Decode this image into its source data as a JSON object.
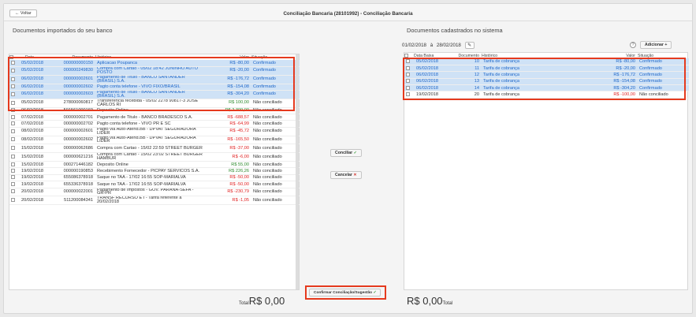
{
  "header": {
    "back_label": "Voltar",
    "title": "Conciliação Bancaria (28101992) - Conciliação Bancaria"
  },
  "left": {
    "heading": "Documentos importados do seu banco",
    "columns": [
      "Data",
      "Documento",
      "Histórico",
      "Valor",
      "Situação"
    ],
    "rows": [
      {
        "date": "05/02/2018",
        "doc": "000000000150",
        "hist": "Aplicacao Poupanca",
        "value": "R$ -80,00",
        "sign": "neg",
        "status": "Confirmado",
        "selected": true,
        "tall": false
      },
      {
        "date": "05/02/2018",
        "doc": "000000249830",
        "hist": "Compra com Cartao - 05/02 18:42 JUNINHO AUTO POSTO",
        "value": "R$ -20,00",
        "sign": "neg",
        "status": "Confirmado",
        "selected": true,
        "tall": true
      },
      {
        "date": "06/02/2018",
        "doc": "000000002601",
        "hist": "Pagamento de Titulo - BANCO SANTANDER (BRASIL) S.A.",
        "value": "R$ -176,72",
        "sign": "neg",
        "status": "Confirmado",
        "selected": true,
        "tall": true
      },
      {
        "date": "06/02/2018",
        "doc": "000000002602",
        "hist": "Pagto conta telefone - VIVO FIXO/BRASIL",
        "value": "R$ -154,08",
        "sign": "neg",
        "status": "Confirmado",
        "selected": true,
        "tall": false
      },
      {
        "date": "06/02/2018",
        "doc": "000000002603",
        "hist": "Pagamento de Titulo - BANCO SANTANDER (BRASIL) S.A.",
        "value": "R$ -304,20",
        "sign": "neg",
        "status": "Confirmado",
        "selected": true,
        "tall": true
      },
      {
        "date": "05/02/2018",
        "doc": "278000060817",
        "hist": "Transferencia recebida - 05/02 2278 90817-3 JOSE CARLOS RI",
        "value": "R$ 100,00",
        "sign": "pos",
        "status": "Não conciliado",
        "selected": false,
        "tall": true
      },
      {
        "date": "06/02/2018",
        "doc": "591561000169",
        "hist": "Deposito Online",
        "value": "R$ 2.309,00",
        "sign": "pos",
        "status": "Não conciliado",
        "selected": false,
        "tall": false
      },
      {
        "date": "07/02/2018",
        "doc": "000000002701",
        "hist": "Pagamento de Titulo - BANCO BRADESCO S.A.",
        "value": "R$ -688,57",
        "sign": "neg",
        "status": "Não conciliado",
        "selected": false,
        "tall": false
      },
      {
        "date": "07/02/2018",
        "doc": "000000002702",
        "hist": "Pagto conta telefone - VIVO PR E SC",
        "value": "R$ -64,99",
        "sign": "neg",
        "status": "Não conciliado",
        "selected": false,
        "tall": false
      },
      {
        "date": "08/02/2018",
        "doc": "000000002601",
        "hist": "Pagto via Auto-Atend.BB - DPVAT SEGURADORA LIDER",
        "value": "R$ -45,72",
        "sign": "neg",
        "status": "Não conciliado",
        "selected": false,
        "tall": true
      },
      {
        "date": "08/02/2018",
        "doc": "000000002602",
        "hist": "Pagto via Auto-Atend.BB - DPVAT SEGURADORA LIDER",
        "value": "R$ -165,50",
        "sign": "neg",
        "status": "Não conciliado",
        "selected": false,
        "tall": true
      },
      {
        "date": "15/02/2018",
        "doc": "000000062686",
        "hist": "Compra com Cartao - 15/02 22:59 STREET BURGER",
        "value": "R$ -37,00",
        "sign": "neg",
        "status": "Não conciliado",
        "selected": false,
        "tall": true
      },
      {
        "date": "15/02/2018",
        "doc": "000000621216",
        "hist": "Compra com Cartao - 15/02 23:02 STREET BURGER HAMBUR",
        "value": "R$ -6,00",
        "sign": "neg",
        "status": "Não conciliado",
        "selected": false,
        "tall": true
      },
      {
        "date": "15/02/2018",
        "doc": "000271446182",
        "hist": "Deposito Online",
        "value": "R$ 55,00",
        "sign": "pos",
        "status": "Não conciliado",
        "selected": false,
        "tall": false
      },
      {
        "date": "19/02/2018",
        "doc": "000000190853",
        "hist": "Recebimento Fornecedor - PICPAY SERVICOS S.A.",
        "value": "R$ 226,26",
        "sign": "pos",
        "status": "Não conciliado",
        "selected": false,
        "tall": false
      },
      {
        "date": "19/02/2018",
        "doc": "655086378918",
        "hist": "Saque no TAA - 17/02 16:55 SOP-MARIALVA",
        "value": "R$ -50,00",
        "sign": "neg",
        "status": "Não conciliado",
        "selected": false,
        "tall": false
      },
      {
        "date": "19/02/2018",
        "doc": "655336378918",
        "hist": "Saque no TAA - 17/02 16:55 SOP-MARIALVA",
        "value": "R$ -50,00",
        "sign": "neg",
        "status": "Não conciliado",
        "selected": false,
        "tall": false
      },
      {
        "date": "20/02/2018",
        "doc": "000000022001",
        "hist": "Pagamento de Impostos - GOV. PARANA-SEFA - GR-PR",
        "value": "R$ -230,79",
        "sign": "neg",
        "status": "Não conciliado",
        "selected": false,
        "tall": true
      },
      {
        "date": "20/02/2018",
        "doc": "511200084341",
        "hist": "TRANSF RECURSO E I - Tarifa referente a 20/02/2018",
        "value": "R$ -1,05",
        "sign": "neg",
        "status": "Não conciliado",
        "selected": false,
        "tall": true
      }
    ],
    "total_label": "Total",
    "total_value": "R$ 0,00"
  },
  "middle": {
    "conciliar_label": "Conciliar",
    "cancelar_label": "Cancelar",
    "confirmar_label": "Confirmar Conciliação/Sugestão"
  },
  "right": {
    "heading": "Documentos cadastrados no sistema",
    "date_from": "01/02/2018",
    "date_sep": "à",
    "date_to": "28/02/2018",
    "add_label": "Adicionar",
    "help_label": "?",
    "columns": [
      "Data Baixa",
      "Documento",
      "Histórico",
      "Valor",
      "Situação"
    ],
    "rows": [
      {
        "date": "05/02/2018",
        "doc": "10",
        "hist": "Tarifa de cobrança",
        "value": "R$ -80,00",
        "status": "Confirmado",
        "selected": true
      },
      {
        "date": "05/02/2018",
        "doc": "11",
        "hist": "Tarifa de cobrança",
        "value": "R$ -20,00",
        "status": "Confirmado",
        "selected": true
      },
      {
        "date": "06/02/2018",
        "doc": "12",
        "hist": "Tarifa de cobrança",
        "value": "R$ -176,72",
        "status": "Confirmado",
        "selected": true
      },
      {
        "date": "06/02/2018",
        "doc": "13",
        "hist": "Tarifa de cobrança",
        "value": "R$ -154,08",
        "status": "Confirmado",
        "selected": true
      },
      {
        "date": "06/02/2018",
        "doc": "14",
        "hist": "Tarifa de cobrança",
        "value": "R$ -304,20",
        "status": "Confirmado",
        "selected": true
      },
      {
        "date": "19/02/2018",
        "doc": "20",
        "hist": "Tarifa de cobrança",
        "value": "R$ -100,00",
        "status": "Não conciliado",
        "selected": false
      }
    ],
    "total_label": "Total",
    "total_value": "R$ 0,00"
  },
  "colors": {
    "selected_bg": "#cfe2f6",
    "selected_text": "#1f67c8",
    "negative": "#e02020",
    "positive": "#2d8a2d",
    "highlight_box": "#e53a1e"
  },
  "icons": {
    "back": "arrow-left-icon",
    "check": "check-icon",
    "cancel": "close-icon",
    "pencil": "pencil-icon",
    "plus": "plus-icon",
    "help": "help-circle-icon"
  }
}
